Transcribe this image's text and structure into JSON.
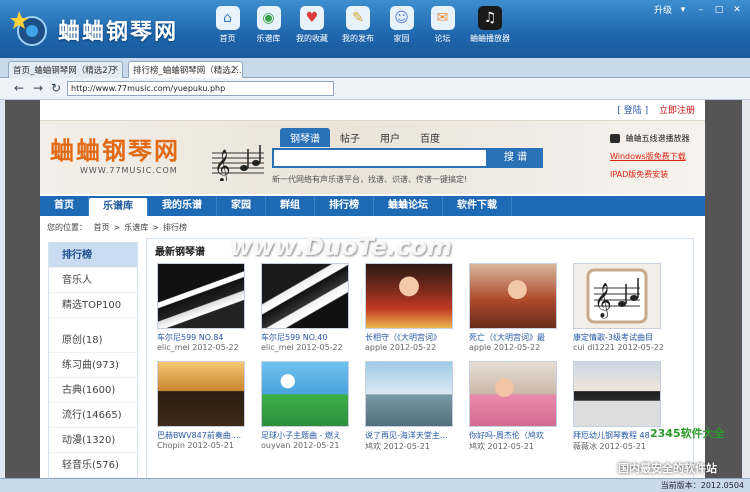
{
  "app": {
    "title": "蛐蛐钢琴网",
    "toolbar": [
      {
        "label": "首页",
        "icon": "home-icon",
        "glyph": "⌂",
        "color": "#3b7fd0"
      },
      {
        "label": "乐谱库",
        "icon": "globe-icon",
        "glyph": "◉",
        "color": "#3aa04a"
      },
      {
        "label": "我的收藏",
        "icon": "heart-icon",
        "glyph": "♥",
        "color": "#e03a3a"
      },
      {
        "label": "我的发布",
        "icon": "pen-icon",
        "glyph": "✎",
        "color": "#d4a52c"
      },
      {
        "label": "家园",
        "icon": "people-icon",
        "glyph": "☺",
        "color": "#5b7fe0"
      },
      {
        "label": "论坛",
        "icon": "chat-icon",
        "glyph": "✉",
        "color": "#e88a2a"
      },
      {
        "label": "蛐蛐播放器",
        "icon": "piano-icon",
        "glyph": "♫",
        "color": "#ffffff"
      }
    ],
    "window_controls": {
      "upgrade": "升级"
    }
  },
  "tabs": [
    {
      "label": "首页_蛐蛐钢琴网（精选2万",
      "close": "×",
      "active": false
    },
    {
      "label": "排行榜_蛐蛐钢琴网（精选2...",
      "close": "×",
      "active": true
    }
  ],
  "address": {
    "url": "http://www.77music.com/yuepuku.php"
  },
  "page": {
    "login": "[ 登陆 ]",
    "register": "立即注册",
    "site_name": "蛐蛐钢琴网",
    "site_url": "WWW.77MUSIC.COM",
    "search_tabs": [
      "钢琴谱",
      "帖子",
      "用户",
      "百度"
    ],
    "search_button": "搜 谱",
    "slogan": "新一代网络有声乐谱平台，找谱、识谱、传谱一键搞定!",
    "player_link": "蛐蛐五线谱播放器",
    "windows_link": "Windows版免费下载",
    "ipad_link": "IPAD版免费安装",
    "nav": [
      "首页",
      "乐谱库",
      "我的乐谱",
      "家园",
      "群组",
      "排行榜",
      "蛐蛐论坛",
      "软件下载"
    ],
    "breadcrumb": {
      "prefix": "您的位置：",
      "items": [
        "首页",
        ">",
        "乐谱库",
        ">",
        "排行榜"
      ]
    },
    "sidebar": [
      "排行榜",
      "音乐人",
      "精选TOP100",
      "原创(18)",
      "练习曲(973)",
      "古典(1600)",
      "流行(14665)",
      "动漫(1320)",
      "轻音乐(576)"
    ],
    "section_title": "最新钢琴谱",
    "cards": [
      {
        "title": "车尔尼599 NO.84",
        "meta": "elic_mei 2012-05-22"
      },
      {
        "title": "车尔尼599 NO.40",
        "meta": "elic_mei 2012-05-22"
      },
      {
        "title": "长相守（《大明宫词》",
        "meta": "apple 2012-05-22"
      },
      {
        "title": "死亡（《大明宫词》最",
        "meta": "apple 2012-05-22"
      },
      {
        "title": "康定情歌-3级考试曲目",
        "meta": "cui dl1221 2012-05-22"
      },
      {
        "title": "巴赫BWV847前奏曲 ...",
        "meta": "Chopin 2012-05-21"
      },
      {
        "title": "足球小子主题曲 - 燃え",
        "meta": "ouyvan 2012-05-21"
      },
      {
        "title": "说了再见-海洋天堂主...",
        "meta": "鸠欢 2012-05-21"
      },
      {
        "title": "你好吗-周杰伦（鸠欢",
        "meta": "鸠欢 2012-05-21"
      },
      {
        "title": "拜厄幼儿钢琴教程 48",
        "meta": "薇薇冰 2012-05-21"
      }
    ]
  },
  "status": {
    "version": "当前版本：2012.0504"
  },
  "watermarks": {
    "center": "www.DuoTe.com",
    "bottom": "国内最安全的软件站",
    "corner": "2345软件大全"
  }
}
